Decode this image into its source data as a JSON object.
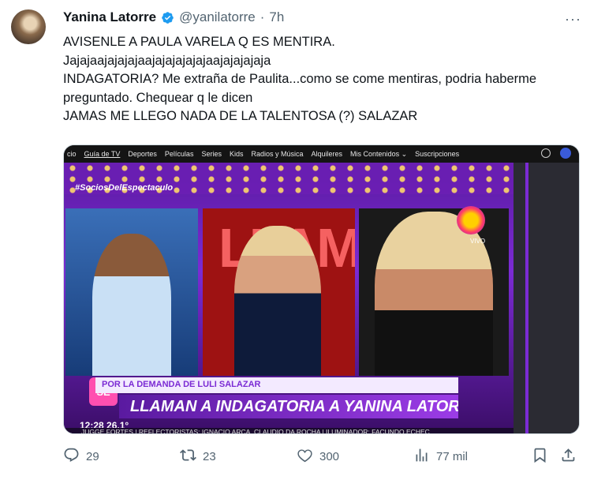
{
  "author": {
    "name": "Yanina Latorre",
    "handle": "@yanilatorre",
    "separator": "·",
    "time": "7h",
    "more_label": "···"
  },
  "tweet": {
    "text": "AVISENLE A PAULA VARELA Q ES MENTIRA.\nJajajaajajajajaajajajajajajaajajajajaja\nINDAGATORIA? Me extraña de Paulita...como se come mentiras, podria haberme preguntado. Chequear q le dicen\nJAMAS ME LLEGO NADA DE LA TALENTOSA (?) SALAZAR"
  },
  "media": {
    "nav": [
      "cio",
      "Guía de TV",
      "Deportes",
      "Películas",
      "Series",
      "Kids",
      "Radios y Música",
      "Alquileres",
      "Mis Contenidos ⌄",
      "Suscripciones"
    ],
    "hashtag": "#SociosDelEspectaculo",
    "backdrop_text": "LLAM",
    "live_label": "VIVO",
    "show_logo": "SE",
    "lower_third": "POR LA DEMANDA DE LULI SALAZAR",
    "headline": "LLAMAN A INDAGATORIA A YANINA LATORRE",
    "clock": "12:28   26,1°",
    "ticker": "JUGGE FORTES | REFLECTORISTAS: IGNACIO ARCA, CLAUDIO DA ROCHA | ILUMINADOR: FACUNDO ECHEC"
  },
  "actions": {
    "replies": "29",
    "retweets": "23",
    "likes": "300",
    "views": "77 mil"
  },
  "colors": {
    "verified": "#1d9bf0",
    "muted": "#536471",
    "accent_purple": "#7b2bd4"
  }
}
